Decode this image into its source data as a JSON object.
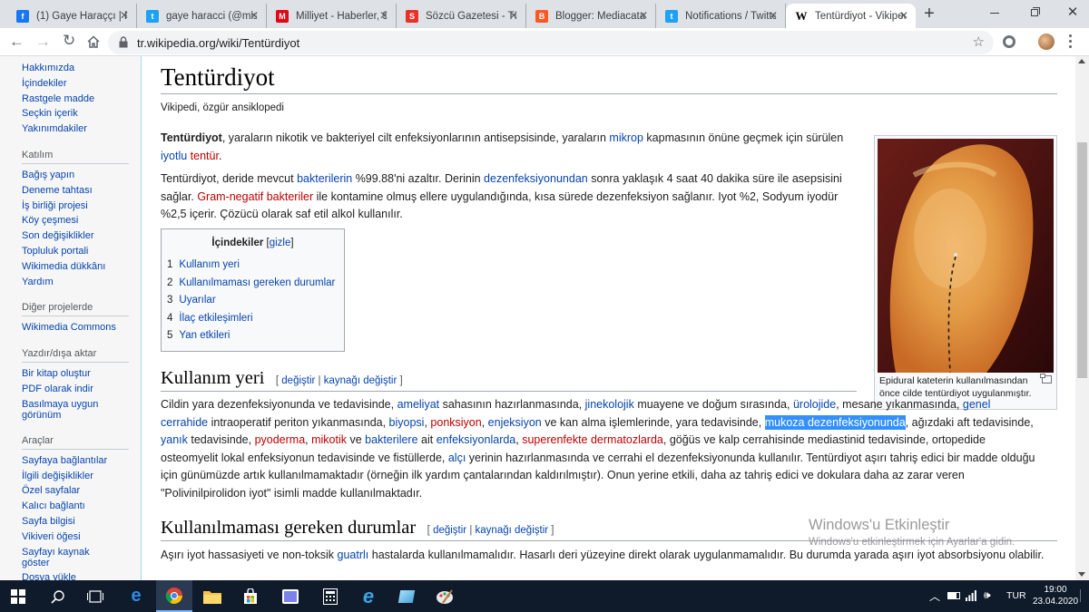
{
  "browser": {
    "tabs": [
      {
        "title": "(1) Gaye Haraççı | Fa",
        "icon": "facebook-icon",
        "color": "#1877f2"
      },
      {
        "title": "gaye haracci (@missga",
        "icon": "twitter-icon",
        "color": "#1da1f2"
      },
      {
        "title": "Milliyet - Haberler, S",
        "icon": "milliyet-icon",
        "color": "#e30613"
      },
      {
        "title": "Sözcü Gazetesi - Tüm",
        "icon": "sozcu-icon",
        "color": "#e8312a"
      },
      {
        "title": "Blogger: Mediacatalog",
        "icon": "blogger-icon",
        "color": "#ff5722"
      },
      {
        "title": "Notifications / Twitter",
        "icon": "twitter-icon",
        "color": "#1da1f2"
      },
      {
        "title": "Tentürdiyot - Vikiped",
        "icon": "wikipedia-icon",
        "color": "#000000"
      }
    ],
    "url": "tr.wikipedia.org/wiki/Tentürdiyot"
  },
  "sidebar": {
    "top_links": [
      "Hakkımızda",
      "İçindekiler",
      "Rastgele madde",
      "Seçkin içerik",
      "Yakınımdakiler"
    ],
    "sections": [
      {
        "heading": "Katılım",
        "links": [
          "Bağış yapın",
          "Deneme tahtası",
          "İş birliği projesi",
          "Köy çeşmesi",
          "Son değişiklikler",
          "Topluluk portali",
          "Wikimedia dükkânı",
          "Yardım"
        ]
      },
      {
        "heading": "Diğer projelerde",
        "links": [
          "Wikimedia Commons"
        ]
      },
      {
        "heading": "Yazdır/dışa aktar",
        "links": [
          "Bir kitap oluştur",
          "PDF olarak indir",
          "Basılmaya uygun görünüm"
        ]
      },
      {
        "heading": "Araçlar",
        "links": [
          "Sayfaya bağlantılar",
          "İlgili değişiklikler",
          "Özel sayfalar",
          "Kalıcı bağlantı",
          "Sayfa bilgisi",
          "Vikiveri öğesi",
          "Sayfayı kaynak göster",
          "Dosya yükle"
        ]
      }
    ]
  },
  "article": {
    "title": "Tentürdiyot",
    "tagline": "Vikipedi, özgür ansiklopedi",
    "p1": {
      "bold": "Tentürdiyot",
      "t1": ", yaraların nikotik ve bakteriyel cilt enfeksiyonlarının antisepsisinde, yaraların ",
      "l1": "mikrop",
      "t2": " kapmasının önüne geçmek için sürülen ",
      "l2": "iyotlu",
      "t3": " ",
      "l3": "tentür",
      "t4": "."
    },
    "p2": {
      "t1": "Tentürdiyot, deride mevcut ",
      "l1": "bakterilerin",
      "t2": " %99.88'ni azaltır. Derinin ",
      "l2": "dezenfeksiyonundan",
      "t3": " sonra yaklaşık 4 saat 40 dakika süre ile asepsisini sağlar. ",
      "l3": "Gram-negatif bakteriler",
      "t4": " ile kontamine olmuş ellere uygulandığında, kısa sürede dezenfeksiyon sağlanır. Iyot %2, Sodyum iyodür %2,5 içerir. Çözücü olarak saf etil alkol kullanılır."
    },
    "toc": {
      "title": "İçindekiler",
      "toggle": "gizle",
      "items": [
        {
          "num": "1",
          "label": "Kullanım yeri"
        },
        {
          "num": "2",
          "label": "Kullanılmaması gereken durumlar"
        },
        {
          "num": "3",
          "label": "Uyarılar"
        },
        {
          "num": "4",
          "label": "İlaç etkileşimleri"
        },
        {
          "num": "5",
          "label": "Yan etkileri"
        }
      ]
    },
    "image_caption": "Epidural kateterin kullanılmasından önce cilde tentürdiyot uygulanmıştır.",
    "sec1": {
      "title": "Kullanım yeri",
      "edit": "değiştir",
      "edit_source": "kaynağı değiştir",
      "parts": [
        {
          "t": "Cildin yara dezenfeksiyonunda ve tedavisinde, "
        },
        {
          "l": "ameliyat"
        },
        {
          "t": " sahasının hazırlanmasında, "
        },
        {
          "l": "jinekolojik"
        },
        {
          "t": " muayene ve doğum sırasında, "
        },
        {
          "l": "ürolojide"
        },
        {
          "t": ", mesane yıkanmasında, "
        },
        {
          "l": "genel cerrahide"
        },
        {
          "t": " intraoperatif periton yıkanmasında, "
        },
        {
          "l": "biyopsi"
        },
        {
          "t": ", "
        },
        {
          "r": "ponksiyon"
        },
        {
          "t": ", "
        },
        {
          "l": "enjeksiyon"
        },
        {
          "t": " ve kan alma işlemlerinde, yara tedavisinde, "
        },
        {
          "h": "mukoza dezenfeksiyonunda"
        },
        {
          "t": ", ağızdaki aft tedavisinde, "
        },
        {
          "l": "yanık"
        },
        {
          "t": " tedavisinde, "
        },
        {
          "r": "pyoderma"
        },
        {
          "t": ", "
        },
        {
          "r": "mikotik"
        },
        {
          "t": " ve "
        },
        {
          "l": "bakterilere"
        },
        {
          "t": " ait "
        },
        {
          "l": "enfeksiyonlarda"
        },
        {
          "t": ", "
        },
        {
          "r": "superenfekte dermatozlarda"
        },
        {
          "t": ", göğüs ve kalp cerrahisinde mediastinid tedavisinde, ortopedide osteomyelit lokal enfeksiyonun tedavisinde ve fistüllerde, "
        },
        {
          "l": "alçı"
        },
        {
          "t": " yerinin hazırlanmasında ve cerrahi el dezenfeksiyonunda kullanılır. Tentürdiyot aşırı tahriş edici bir madde olduğu için günümüzde artık kullanılmamaktadır (örneğin ilk yardım çantalarından kaldırılmıştır). Onun yerine etkili, daha az tahriş edici ve dokulara daha az zarar veren \"Polivinilpirolidon iyot\" isimli madde kullanılmaktadır."
        }
      ]
    },
    "sec2": {
      "title": "Kullanılmaması gereken durumlar",
      "edit": "değiştir",
      "edit_source": "kaynağı değiştir",
      "parts": [
        {
          "t": "Aşırı iyot hassasiyeti ve non-toksik "
        },
        {
          "l": "guatrlı"
        },
        {
          "t": " hastalarda kullanılmamalıdır. Hasarlı deri yüzeyine direkt olarak uygulanmamalıdır. Bu durumda yarada aşırı iyot absorbsiyonu olabilir."
        }
      ]
    }
  },
  "watermark": {
    "title": "Windows'u Etkinleştir",
    "subtitle": "Windows'u etkinleştirmek için Ayarlar'a gidin."
  },
  "taskbar": {
    "lang": "TUR",
    "time": "19:00",
    "date": "23.04.2020"
  }
}
